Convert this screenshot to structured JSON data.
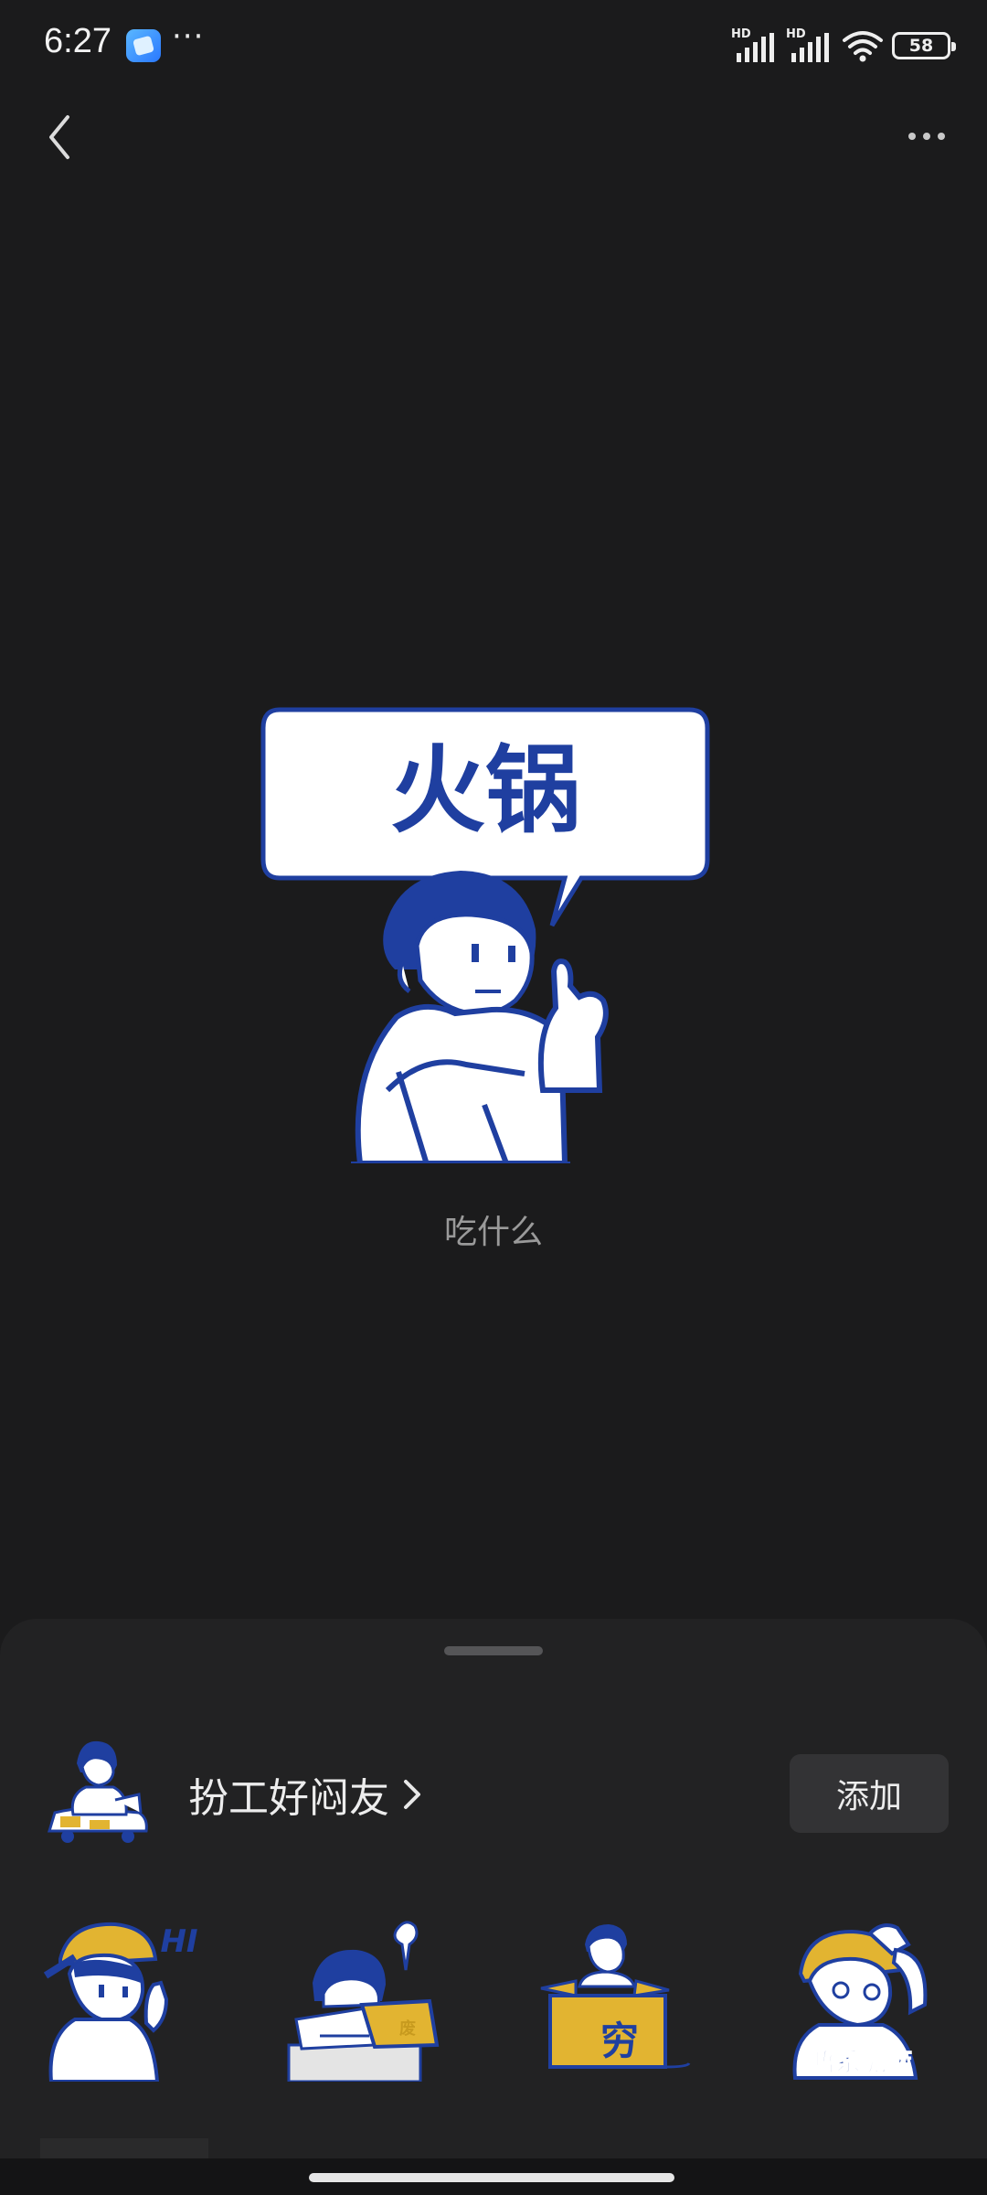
{
  "status_bar": {
    "time": "6:27",
    "more": "···",
    "signal_1_label": "HD",
    "signal_2_label": "HD",
    "battery": "58"
  },
  "icons": {
    "back": "chevron-left-icon",
    "more": "more-horizontal-icon",
    "wifi": "wifi-icon",
    "battery": "battery-icon"
  },
  "sticker": {
    "bubble_text": "火锅",
    "caption": "吃什么"
  },
  "pack": {
    "title": "扮工好闷友",
    "add_label": "添加"
  },
  "pack_stickers": [
    {
      "text": "HI"
    },
    {
      "text": "废"
    },
    {
      "text": "穷"
    },
    {
      "text": "唔系呃嘛"
    }
  ],
  "colors": {
    "sticker_blue": "#1f3fa0",
    "sticker_yellow": "#e2b431",
    "background": "#1b1b1c",
    "sheet": "#222223"
  }
}
